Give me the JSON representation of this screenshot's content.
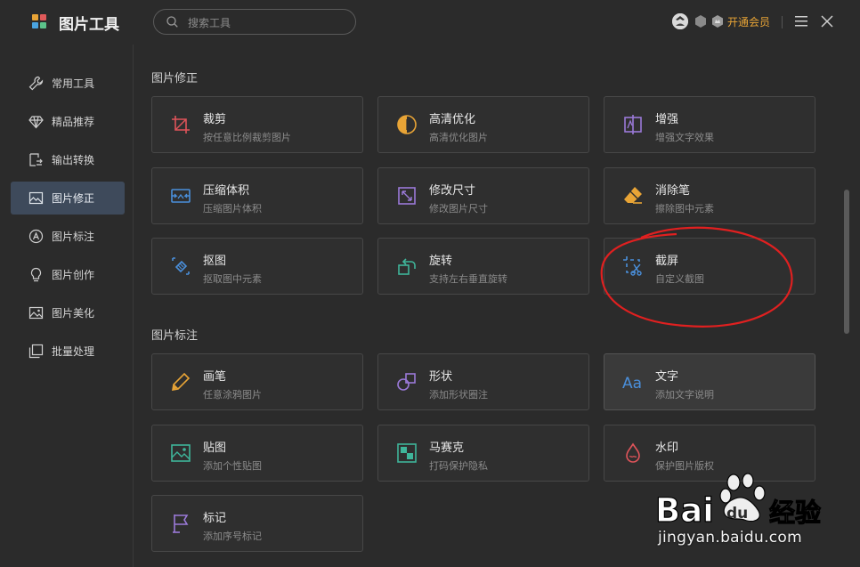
{
  "app": {
    "title": "图片工具",
    "search_placeholder": "搜索工具",
    "vip_label": "开通会员",
    "colors": {
      "accent": "#e8a436",
      "active_nav": "#3e4a5b",
      "annotation": "#e02020"
    }
  },
  "sidebar": {
    "items": [
      {
        "label": "常用工具",
        "icon": "wrench-icon"
      },
      {
        "label": "精品推荐",
        "icon": "diamond-icon"
      },
      {
        "label": "输出转换",
        "icon": "convert-icon"
      },
      {
        "label": "图片修正",
        "icon": "image-fix-icon",
        "active": true
      },
      {
        "label": "图片标注",
        "icon": "annotate-icon"
      },
      {
        "label": "图片创作",
        "icon": "bulb-icon"
      },
      {
        "label": "图片美化",
        "icon": "image-beautify-icon"
      },
      {
        "label": "批量处理",
        "icon": "batch-icon"
      }
    ]
  },
  "sections": [
    {
      "title": "图片修正",
      "cards": [
        {
          "title": "裁剪",
          "desc": "按任意比例裁剪图片",
          "icon": "crop-icon"
        },
        {
          "title": "高清优化",
          "desc": "高清优化图片",
          "icon": "hd-icon"
        },
        {
          "title": "增强",
          "desc": "增强文字效果",
          "icon": "enhance-icon"
        },
        {
          "title": "压缩体积",
          "desc": "压缩图片体积",
          "icon": "compress-icon"
        },
        {
          "title": "修改尺寸",
          "desc": "修改图片尺寸",
          "icon": "resize-icon"
        },
        {
          "title": "消除笔",
          "desc": "擦除图中元素",
          "icon": "eraser-icon"
        },
        {
          "title": "抠图",
          "desc": "抠取图中元素",
          "icon": "cutout-icon"
        },
        {
          "title": "旋转",
          "desc": "支持左右垂直旋转",
          "icon": "rotate-icon"
        },
        {
          "title": "截屏",
          "desc": "自定义截图",
          "icon": "screenshot-icon"
        }
      ]
    },
    {
      "title": "图片标注",
      "cards": [
        {
          "title": "画笔",
          "desc": "任意涂鸦图片",
          "icon": "pencil-icon"
        },
        {
          "title": "形状",
          "desc": "添加形状圈注",
          "icon": "shape-icon"
        },
        {
          "title": "文字",
          "desc": "添加文字说明",
          "icon": "text-icon"
        },
        {
          "title": "贴图",
          "desc": "添加个性贴图",
          "icon": "sticker-icon"
        },
        {
          "title": "马赛克",
          "desc": "打码保护隐私",
          "icon": "mosaic-icon"
        },
        {
          "title": "水印",
          "desc": "保护图片版权",
          "icon": "watermark-icon"
        },
        {
          "title": "标记",
          "desc": "添加序号标记",
          "icon": "flag-icon"
        }
      ]
    }
  ],
  "watermark": {
    "brand": "Bai",
    "brand2": "du",
    "brand3": "经验",
    "url": "jingyan.baidu.com"
  }
}
